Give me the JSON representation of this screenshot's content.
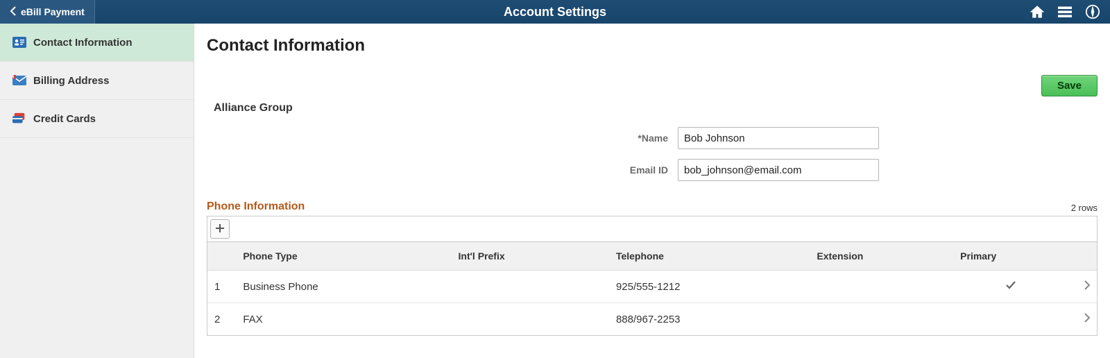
{
  "header": {
    "back_label": "eBill Payment",
    "title": "Account Settings"
  },
  "sidebar": {
    "items": [
      {
        "label": "Contact Information",
        "icon": "contact-card-icon",
        "active": true
      },
      {
        "label": "Billing Address",
        "icon": "address-icon",
        "active": false
      },
      {
        "label": "Credit Cards",
        "icon": "cards-icon",
        "active": false
      }
    ]
  },
  "main": {
    "page_title": "Contact Information",
    "save_label": "Save",
    "group_name": "Alliance Group",
    "form": {
      "name_label": "Name",
      "name_required_marker": "*",
      "name_value": "Bob Johnson",
      "email_label": "Email ID",
      "email_value": "bob_johnson@email.com"
    },
    "phone": {
      "section_title": "Phone Information",
      "rows_count_label": "2 rows",
      "headers": {
        "phone_type": "Phone Type",
        "intl_prefix": "Int'l Prefix",
        "telephone": "Telephone",
        "extension": "Extension",
        "primary": "Primary"
      },
      "rows": [
        {
          "num": "1",
          "type": "Business Phone",
          "prefix": "",
          "tel": "925/555-1212",
          "ext": "",
          "primary": true
        },
        {
          "num": "2",
          "type": "FAX",
          "prefix": "",
          "tel": "888/967-2253",
          "ext": "",
          "primary": false
        }
      ]
    }
  }
}
